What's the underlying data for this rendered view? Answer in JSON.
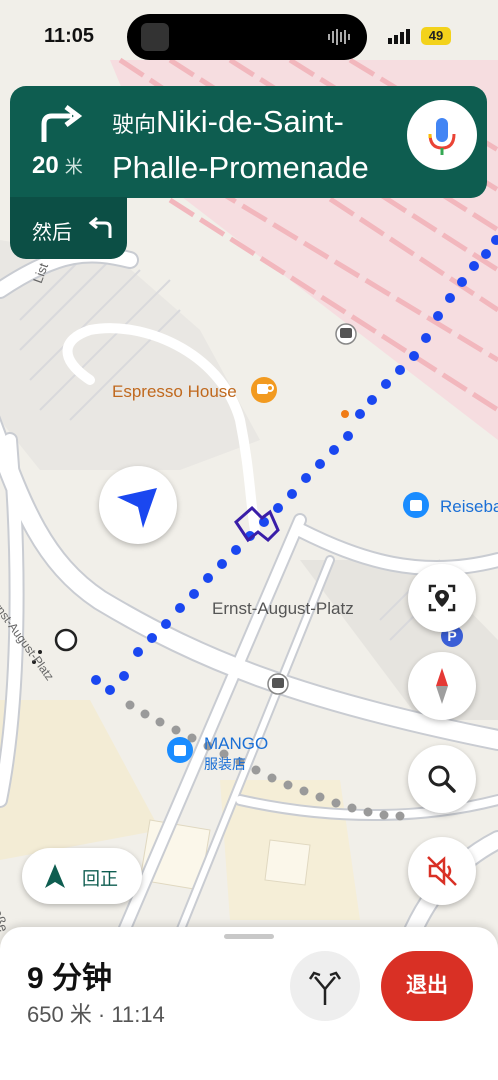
{
  "status_bar": {
    "time": "11:05",
    "battery": "49"
  },
  "navigation": {
    "distance_value": "20",
    "distance_unit": "米",
    "prefix": "驶向",
    "street": "Niki-de-Saint-Phalle-Promenade",
    "then_label": "然后"
  },
  "map": {
    "labels": {
      "espresso": "Espresso House",
      "reiseba": "Reiseba",
      "ernst_platz": "Ernst-August-Platz",
      "mango": "MANGO",
      "mango_sub": "服装店",
      "ernst_side": "Ernst-August-Platz",
      "lister": "List",
      "strasse": "traße"
    }
  },
  "recenter": {
    "label": "回正"
  },
  "trip": {
    "eta": "9 分钟",
    "meta": "650 米 · 11:14",
    "exit_label": "退出"
  },
  "colors": {
    "nav_green": "#0e5d50",
    "route_blue": "#1a47f0",
    "exit_red": "#d93025",
    "poi_orange": "#f29a20",
    "poi_blue": "#1a8cff"
  },
  "icons": [
    "turn-right-icon",
    "mic-icon",
    "turn-left-icon",
    "location-arrow-icon",
    "lens-icon",
    "compass-icon",
    "search-icon",
    "mute-icon",
    "recenter-arrow-icon",
    "alt-routes-icon",
    "coffee-icon",
    "bus-icon",
    "parking-icon",
    "shopping-icon"
  ]
}
